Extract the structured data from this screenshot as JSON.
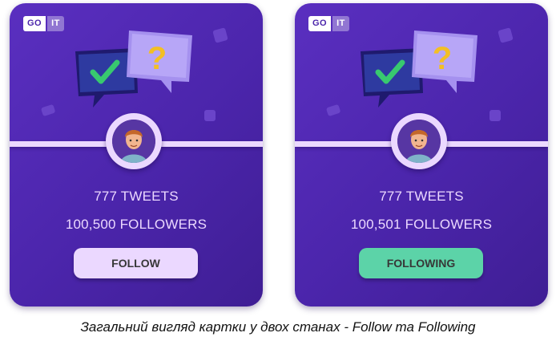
{
  "logo": {
    "part1": "GO",
    "part2": "IT"
  },
  "cards": [
    {
      "tweets": "777 TWEETS",
      "followers": "100,500 FOLLOWERS",
      "button_label": "FOLLOW",
      "button_color": "#ebd8ff"
    },
    {
      "tweets": "777 TWEETS",
      "followers": "100,501 FOLLOWERS",
      "button_label": "FOLLOWING",
      "button_color": "#5cd3a8"
    }
  ],
  "caption": "Загальний вигляд картки у двох станах - Follow та Following",
  "colors": {
    "card_bg": "#4b25ab",
    "accent": "#ebd8ff",
    "following": "#5cd3a8"
  },
  "icons": [
    "goit-logo",
    "checkmark-bubble-icon",
    "question-bubble-icon",
    "avatar"
  ]
}
